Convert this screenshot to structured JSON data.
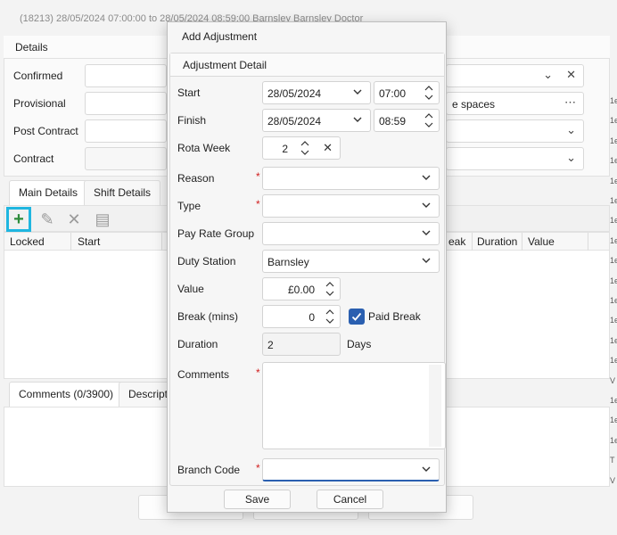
{
  "background": {
    "title": "(18213) 28/05/2024 07:00:00 to 28/05/2024 08:59:00 Barnsley Barnsley Doctor",
    "details_header": "Details",
    "rows": [
      {
        "label": "Confirmed"
      },
      {
        "label": "Provisional",
        "right_text": "e spaces"
      },
      {
        "label": "Post Contract"
      },
      {
        "label": "Contract"
      }
    ],
    "tabs": [
      "Main Details",
      "Shift Details"
    ],
    "grid_columns_left": [
      "Locked",
      "Start"
    ],
    "grid_columns_right": [
      "eak",
      "Duration",
      "Value"
    ],
    "comments_tabs": [
      "Comments (0/3900)",
      "Descriptio"
    ],
    "right_edge_chars": [
      "1e",
      "1e",
      "1e",
      "1e",
      "1e",
      "1e",
      "1e",
      "1e",
      "1e",
      "1e",
      "1e",
      "1e",
      "1e",
      "1e",
      "V",
      "1e",
      "1e",
      "1e",
      "T",
      "V"
    ]
  },
  "modal": {
    "title": "Add Adjustment",
    "section_title": "Adjustment Detail",
    "start": {
      "label": "Start",
      "date": "28/05/2024",
      "time": "07:00"
    },
    "finish": {
      "label": "Finish",
      "date": "28/05/2024",
      "time": "08:59"
    },
    "rota_week": {
      "label": "Rota Week",
      "value": "2"
    },
    "reason": {
      "label": "Reason",
      "required": "*",
      "value": ""
    },
    "type": {
      "label": "Type",
      "required": "*",
      "value": ""
    },
    "pay_rate_group": {
      "label": "Pay Rate Group",
      "value": ""
    },
    "duty_station": {
      "label": "Duty Station",
      "value": "Barnsley"
    },
    "value": {
      "label": "Value",
      "value": "£0.00"
    },
    "break_mins": {
      "label": "Break (mins)",
      "value": "0",
      "paid_break_label": "Paid Break",
      "paid_break_checked": true
    },
    "duration": {
      "label": "Duration",
      "value": "2",
      "unit": "Days"
    },
    "comments": {
      "label": "Comments",
      "required": "*",
      "value": ""
    },
    "branch_code": {
      "label": "Branch Code",
      "required": "*",
      "value": ""
    },
    "save_label": "Save",
    "cancel_label": "Cancel"
  },
  "colors": {
    "accent": "#2a5fb0",
    "required": "#d12020",
    "add_icon": "#2e8b3a",
    "highlight": "#1fb6e0"
  }
}
